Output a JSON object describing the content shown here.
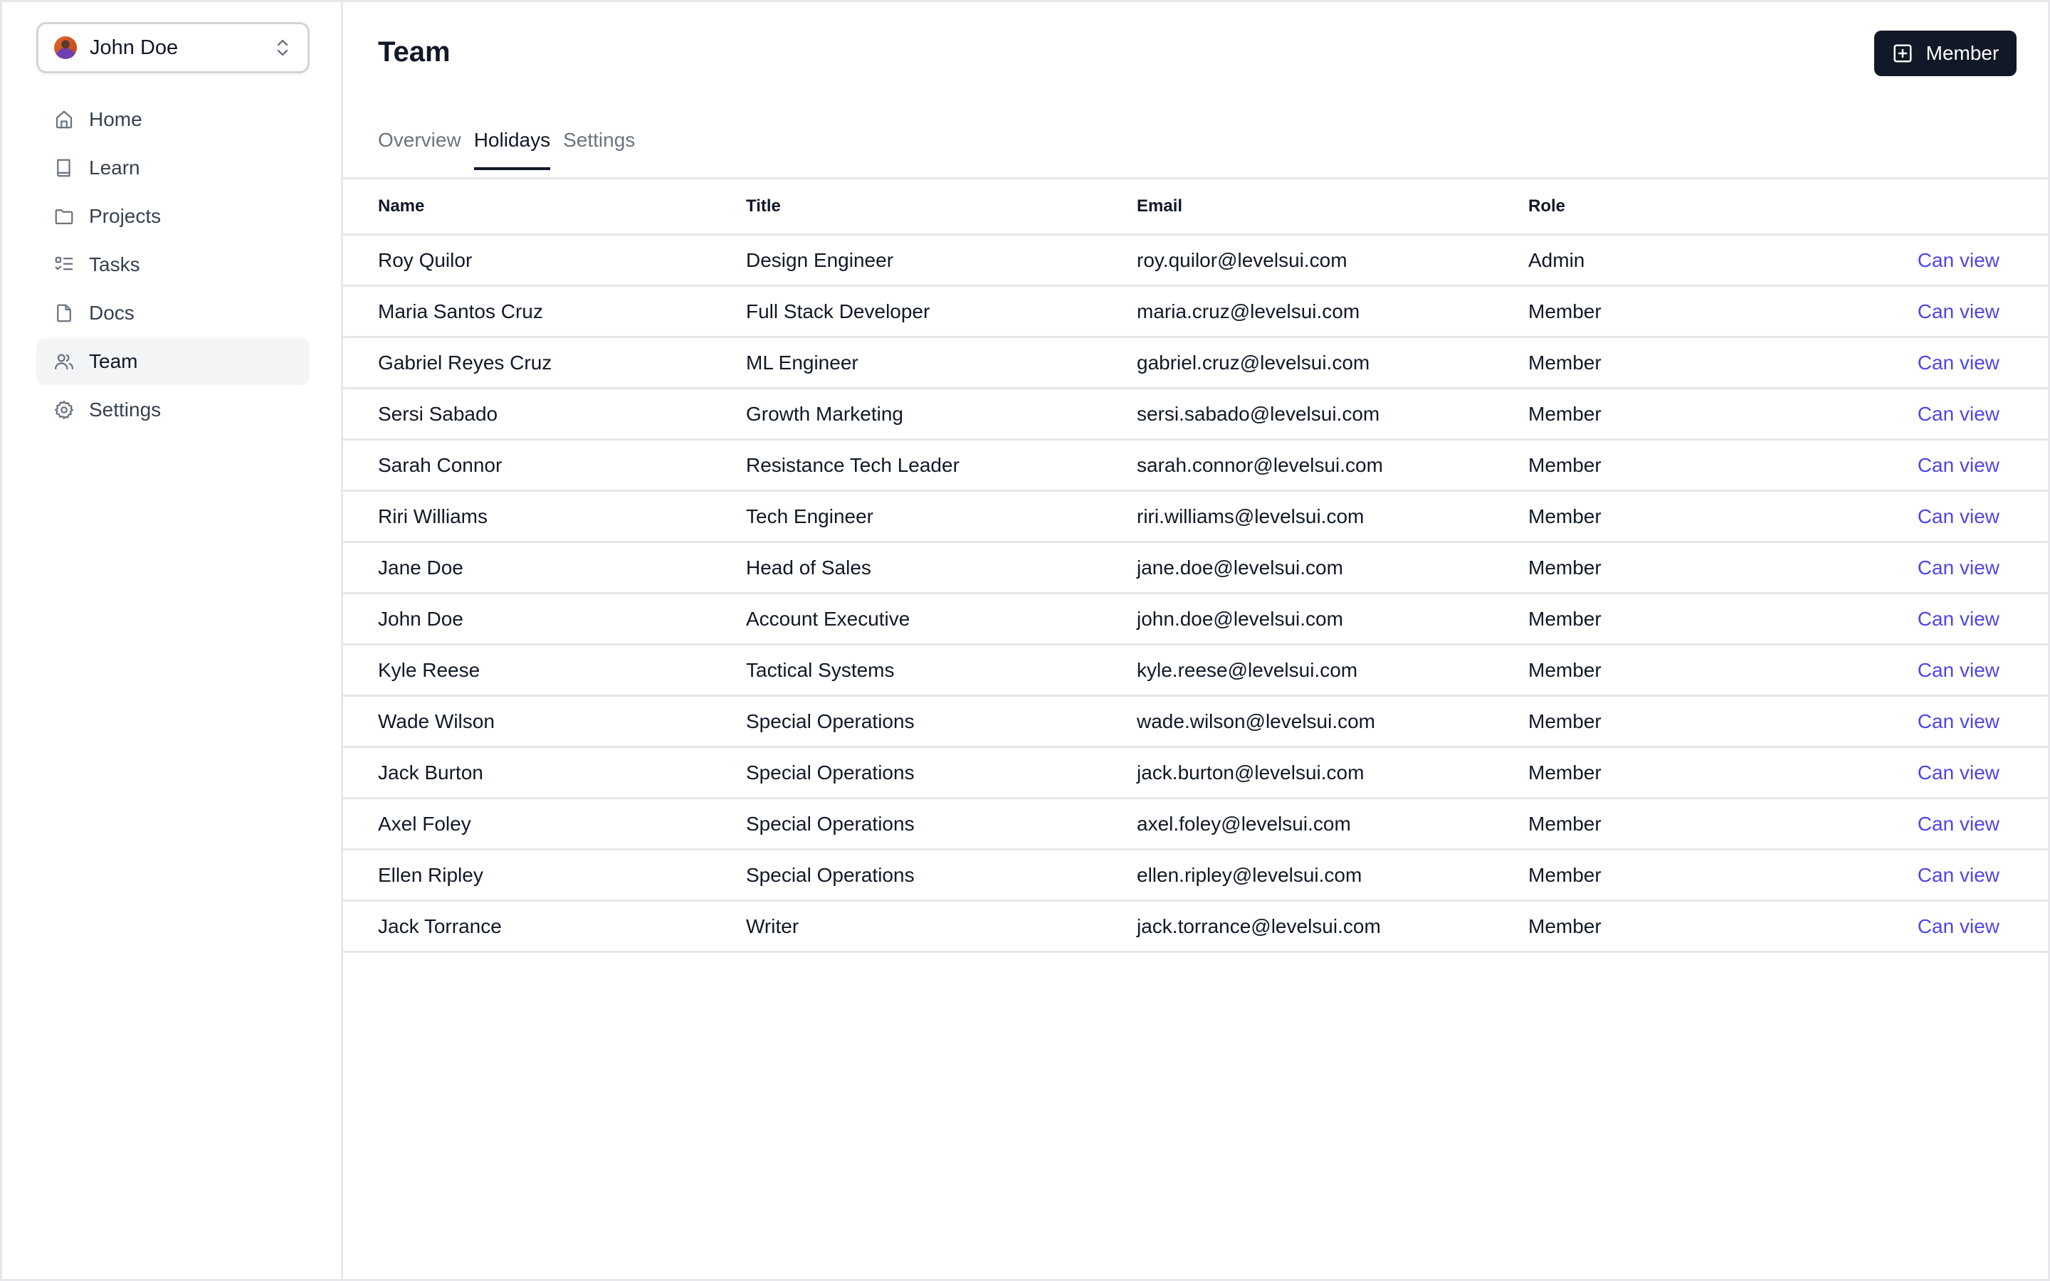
{
  "profile": {
    "name": "John Doe",
    "avatar": "avatar-photo",
    "switcher_icon": "chevron-up-down-icon"
  },
  "sidebar": {
    "items": [
      {
        "label": "Home",
        "icon": "home-icon",
        "active": false
      },
      {
        "label": "Learn",
        "icon": "book-icon",
        "active": false
      },
      {
        "label": "Projects",
        "icon": "folder-icon",
        "active": false
      },
      {
        "label": "Tasks",
        "icon": "checklist-icon",
        "active": false
      },
      {
        "label": "Docs",
        "icon": "document-icon",
        "active": false
      },
      {
        "label": "Team",
        "icon": "users-icon",
        "active": true
      },
      {
        "label": "Settings",
        "icon": "gear-icon",
        "active": false
      }
    ]
  },
  "header": {
    "title": "Team",
    "add_button": {
      "label": "Member",
      "icon": "plus-square-icon"
    }
  },
  "tabs": [
    {
      "label": "Overview",
      "active": false
    },
    {
      "label": "Holidays",
      "active": true
    },
    {
      "label": "Settings",
      "active": false
    }
  ],
  "table": {
    "columns": [
      "Name",
      "Title",
      "Email",
      "Role"
    ],
    "rows": [
      {
        "name": "Roy Quilor",
        "title": "Design Engineer",
        "email": "roy.quilor@levelsui.com",
        "role": "Admin",
        "action": "Can view"
      },
      {
        "name": "Maria Santos Cruz",
        "title": "Full Stack Developer",
        "email": "maria.cruz@levelsui.com",
        "role": "Member",
        "action": "Can view"
      },
      {
        "name": "Gabriel Reyes Cruz",
        "title": "ML Engineer",
        "email": "gabriel.cruz@levelsui.com",
        "role": "Member",
        "action": "Can view"
      },
      {
        "name": "Sersi Sabado",
        "title": "Growth Marketing",
        "email": "sersi.sabado@levelsui.com",
        "role": "Member",
        "action": "Can view"
      },
      {
        "name": "Sarah Connor",
        "title": "Resistance Tech Leader",
        "email": "sarah.connor@levelsui.com",
        "role": "Member",
        "action": "Can view"
      },
      {
        "name": "Riri Williams",
        "title": "Tech Engineer",
        "email": "riri.williams@levelsui.com",
        "role": "Member",
        "action": "Can view"
      },
      {
        "name": "Jane Doe",
        "title": "Head of Sales",
        "email": "jane.doe@levelsui.com",
        "role": "Member",
        "action": "Can view"
      },
      {
        "name": "John Doe",
        "title": "Account Executive",
        "email": "john.doe@levelsui.com",
        "role": "Member",
        "action": "Can view"
      },
      {
        "name": "Kyle Reese",
        "title": "Tactical Systems",
        "email": "kyle.reese@levelsui.com",
        "role": "Member",
        "action": "Can view"
      },
      {
        "name": "Wade Wilson",
        "title": "Special Operations",
        "email": "wade.wilson@levelsui.com",
        "role": "Member",
        "action": "Can view"
      },
      {
        "name": "Jack Burton",
        "title": "Special Operations",
        "email": "jack.burton@levelsui.com",
        "role": "Member",
        "action": "Can view"
      },
      {
        "name": "Axel Foley",
        "title": "Special Operations",
        "email": "axel.foley@levelsui.com",
        "role": "Member",
        "action": "Can view"
      },
      {
        "name": "Ellen Ripley",
        "title": "Special Operations",
        "email": "ellen.ripley@levelsui.com",
        "role": "Member",
        "action": "Can view"
      },
      {
        "name": "Jack Torrance",
        "title": "Writer",
        "email": "jack.torrance@levelsui.com",
        "role": "Member",
        "action": "Can view"
      }
    ]
  },
  "colors": {
    "primary_button": "#111827",
    "link": "#4f46e5",
    "border": "#e5e7eb",
    "active_nav_bg": "#f3f4f6",
    "muted_text": "#6b7280"
  }
}
